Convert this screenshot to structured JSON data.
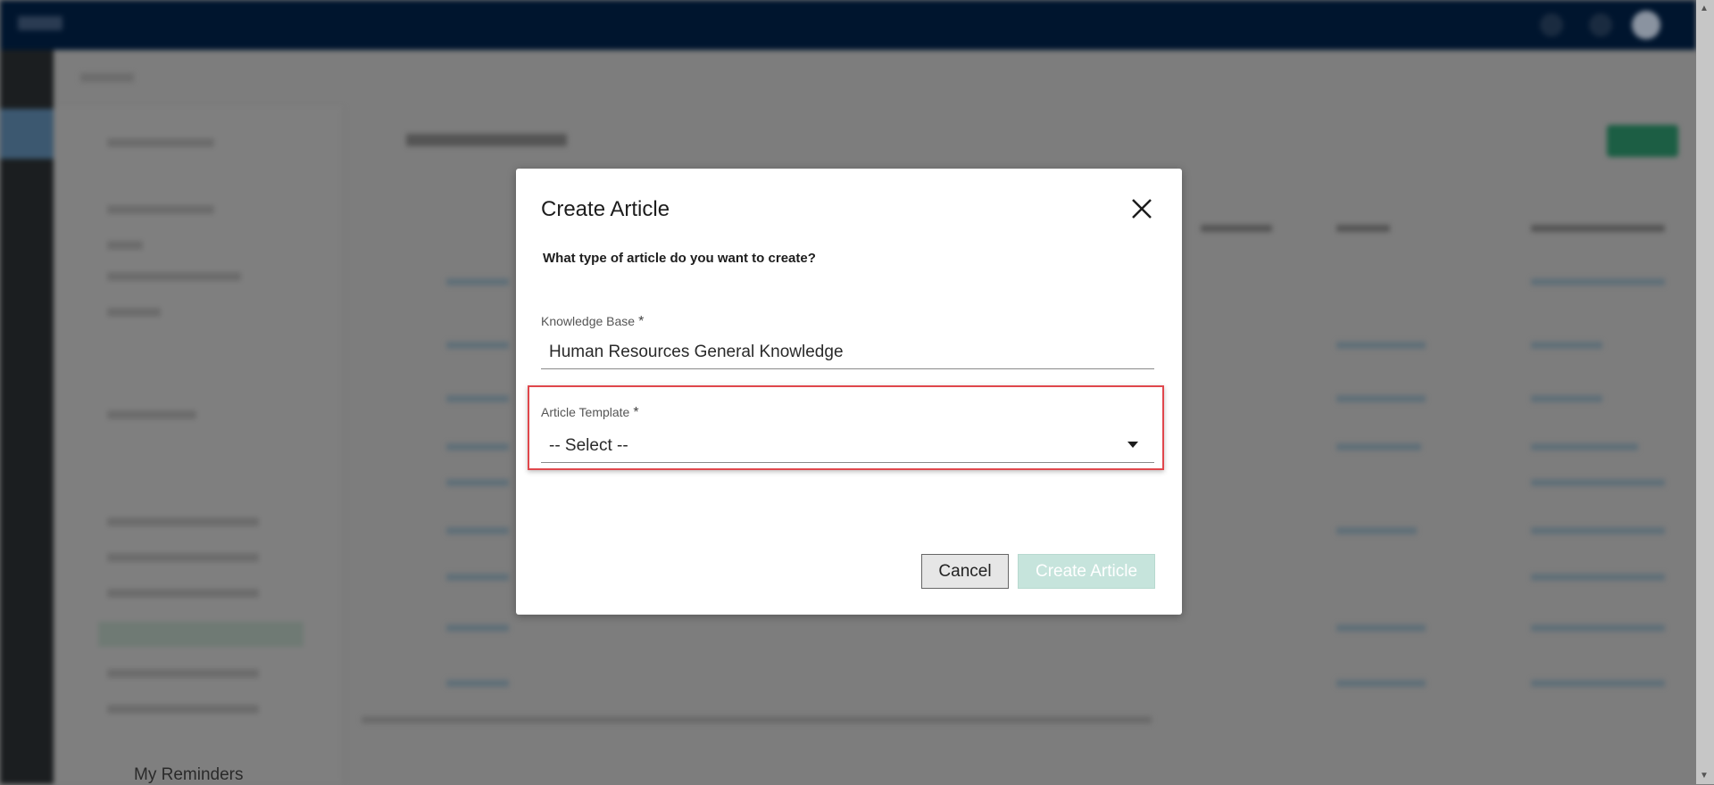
{
  "background": {
    "sidebar_visible_item": "My Reminders"
  },
  "modal": {
    "title": "Create Article",
    "close_icon": "close-icon",
    "prompt": "What type of article do you want to create?",
    "knowledge_base": {
      "label": "Knowledge Base",
      "required_mark": "*",
      "value": "Human Resources General Knowledge"
    },
    "article_template": {
      "label": "Article Template",
      "required_mark": "*",
      "selected": "-- Select --"
    },
    "cancel_label": "Cancel",
    "create_label": "Create Article"
  },
  "colors": {
    "highlight": "#e0474c",
    "create_disabled": "#c6e4dc",
    "nav": "#00152e"
  }
}
